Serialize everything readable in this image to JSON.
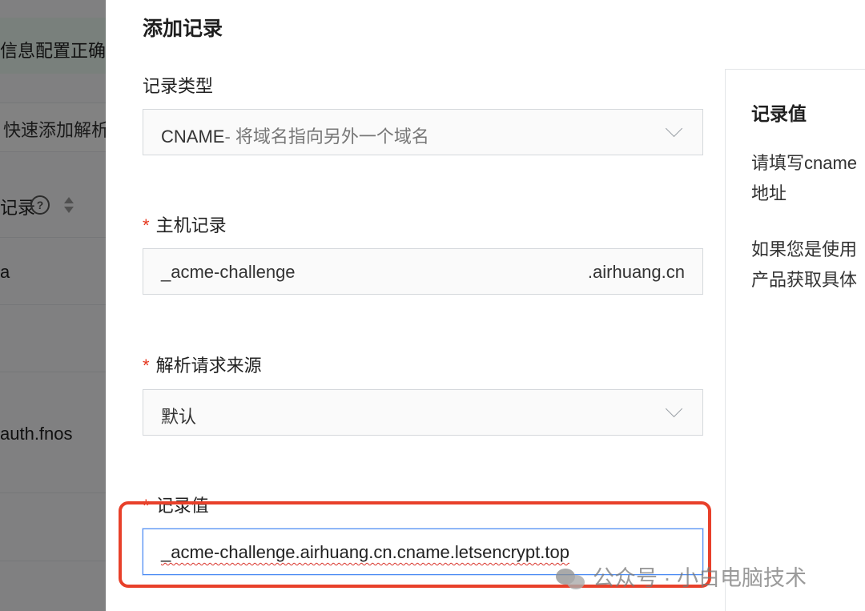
{
  "background": {
    "alert_text": "信息配置正确",
    "quick_add_text": "快速添加解析",
    "table_header": {
      "label": "记录"
    },
    "rows": [
      "a",
      "",
      "auth.fnos",
      "",
      ""
    ]
  },
  "drawer": {
    "title": "添加记录",
    "record_type": {
      "label": "记录类型",
      "value_main": "CNAME",
      "value_desc": "- 将域名指向另外一个域名"
    },
    "host": {
      "required_mark": "*",
      "label": "主机记录",
      "value": "_acme-challenge",
      "suffix": ".airhuang.cn"
    },
    "resolve_source": {
      "required_mark": "*",
      "label": "解析请求来源",
      "value": "默认"
    },
    "record_value": {
      "required_mark": "*",
      "label": "记录值",
      "value": "_acme-challenge.airhuang.cn.cname.letsencrypt.top"
    }
  },
  "help_panel": {
    "title": "记录值",
    "line1": "请填写cname",
    "line2": "地址",
    "line3": "如果您是使用",
    "line4": "产品获取具体"
  },
  "watermark": {
    "text": "公众号 · 小白电脑技术"
  },
  "colors": {
    "required": "#e5381f",
    "focus_border": "#4a8af4",
    "highlight": "#e8402a"
  }
}
